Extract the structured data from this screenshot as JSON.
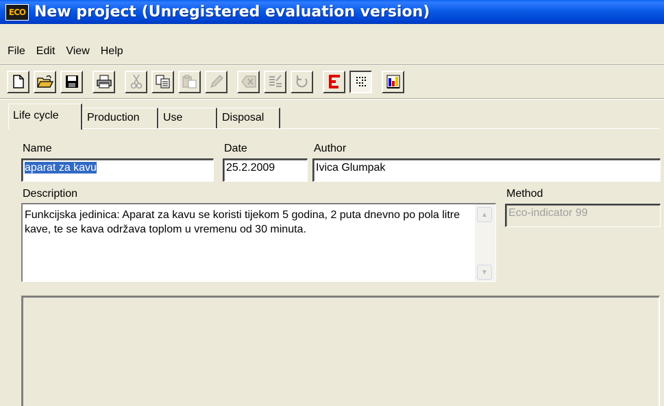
{
  "window": {
    "title": "New project (Unregistered evaluation version)",
    "icon_text": "ECO"
  },
  "menu": {
    "items": [
      "File",
      "Edit",
      "View",
      "Help"
    ]
  },
  "toolbar": {
    "buttons": [
      {
        "icon": "new-document-icon",
        "enabled": true
      },
      {
        "icon": "open-folder-icon",
        "enabled": true
      },
      {
        "icon": "save-disk-icon",
        "enabled": true
      },
      {
        "icon": "print-icon",
        "enabled": true
      },
      {
        "icon": "cut-icon",
        "enabled": false
      },
      {
        "icon": "copy-icon",
        "enabled": true
      },
      {
        "icon": "paste-icon",
        "enabled": false
      },
      {
        "icon": "edit-pencil-icon",
        "enabled": false
      },
      {
        "icon": "delete-icon",
        "enabled": false
      },
      {
        "icon": "sort-icon",
        "enabled": false
      },
      {
        "icon": "undo-icon",
        "enabled": false
      },
      {
        "icon": "results-bar-icon",
        "enabled": true
      },
      {
        "icon": "grid-view-icon",
        "enabled": true,
        "pressed": true
      },
      {
        "icon": "chart-icon",
        "enabled": true
      }
    ]
  },
  "tabs": [
    "Life cycle",
    "Production",
    "Use",
    "Disposal"
  ],
  "active_tab": "Life cycle",
  "form": {
    "name_label": "Name",
    "name_value": "aparat za kavu",
    "date_label": "Date",
    "date_value": "25.2.2009",
    "author_label": "Author",
    "author_value": "Ivica Glumpak",
    "description_label": "Description",
    "description_value": "Funkcijska jedinica: Aparat za kavu se koristi tijekom 5 godina, 2 puta dnevno po pola litre kave, te se kava održava toplom u vremenu od 30 minuta.",
    "method_label": "Method",
    "method_value": "Eco-indicator 99"
  },
  "colors": {
    "titlebar": "#0a5be6",
    "selection": "#316ac5",
    "face": "#ece9d8"
  }
}
